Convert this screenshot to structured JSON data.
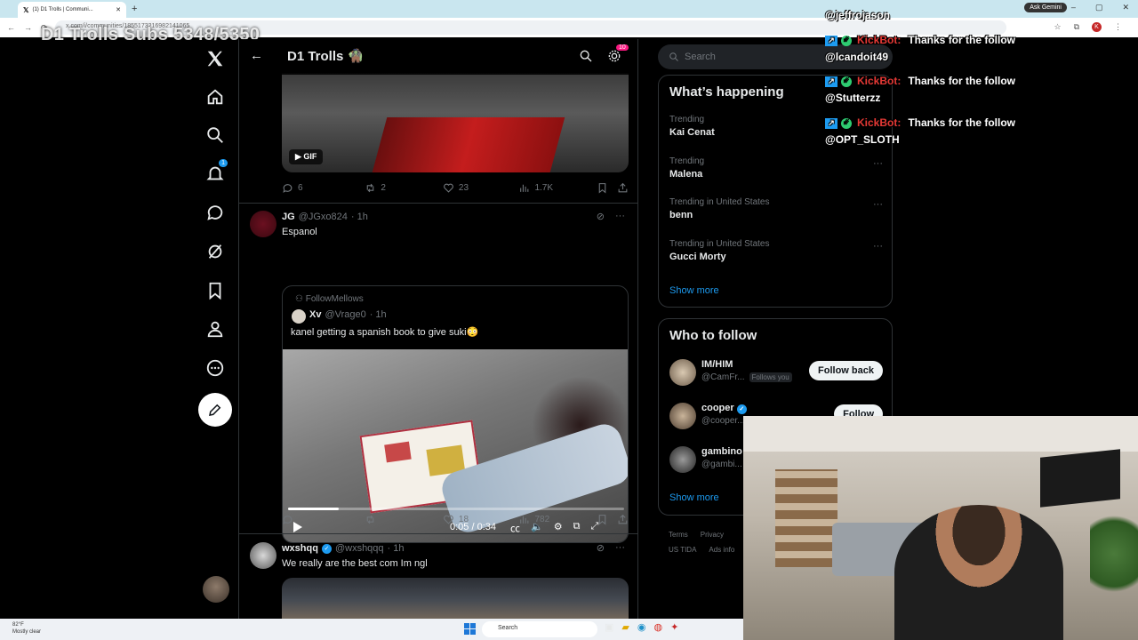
{
  "browser": {
    "tab_title": "(1) D1 Trolls | Communi...",
    "url": "x.com/i/communities/1855173216982141065",
    "ask_gemini": "Ask Gemini"
  },
  "stream_overlay": {
    "title": "D1 Trolls Subs 5348/5350"
  },
  "nav": {
    "notifications_badge": "1"
  },
  "main": {
    "header_title": "D1 Trolls 🧌",
    "settings_badge": "10",
    "gif_label": "GIF",
    "post1_stats": {
      "replies": "6",
      "reposts": "2",
      "likes": "23",
      "views": "1.7K"
    },
    "post2": {
      "name": "JG",
      "handle": "@JGxo824",
      "time": "· 1h",
      "text": "Espanol",
      "quote": {
        "community": "FollowMellows",
        "name": "Xv",
        "handle": "@Vrage0",
        "time": "· 1h",
        "text": "kanel getting a spanish book to give suki😳",
        "video_time": "0:05 / 0:34",
        "video_progress": 0.15
      },
      "stats": {
        "replies": "",
        "reposts": "",
        "likes": "18",
        "views": "782"
      }
    },
    "post3": {
      "name": "wxshqq",
      "handle": "@wxshqqq",
      "time": "· 1h",
      "text": "We really are the best com Im ngl"
    }
  },
  "right": {
    "search_placeholder": "Search",
    "happening_title": "What’s happening",
    "trends": [
      {
        "context": "Trending",
        "name": "Kai Cenat"
      },
      {
        "context": "Trending",
        "name": "Malena"
      },
      {
        "context": "Trending in United States",
        "name": "benn"
      },
      {
        "context": "Trending in United States",
        "name": "Gucci Morty"
      }
    ],
    "show_more": "Show more",
    "wtf_title": "Who to follow",
    "wtf": [
      {
        "name": "IM/HIM",
        "handle": "@CamFr...",
        "follows_you": "Follows you",
        "button": "Follow back"
      },
      {
        "name": "cooper",
        "handle": "@cooper...",
        "button": "Follow"
      },
      {
        "name": "gambino",
        "handle": "@gambi..."
      }
    ],
    "footer": [
      "Terms",
      "Privacy",
      "US TIDA",
      "Ads info"
    ]
  },
  "chat": [
    {
      "user": "@jeffrojason"
    },
    {
      "bot": "KickBot:",
      "msg": "Thanks for the follow",
      "user": "@lcandoit49"
    },
    {
      "bot": "KickBot:",
      "msg": "Thanks for the follow",
      "user": "@Stutterzz"
    },
    {
      "bot": "KickBot:",
      "msg": "Thanks for the follow",
      "user": "@OPT_SLOTH"
    }
  ],
  "taskbar": {
    "temp": "82°F",
    "weather": "Mostly clear",
    "search": "Search"
  },
  "colors": {
    "accent": "#1d9bf0",
    "bg": "#000000",
    "border": "#2f3336",
    "kickbot": "#e53935"
  }
}
